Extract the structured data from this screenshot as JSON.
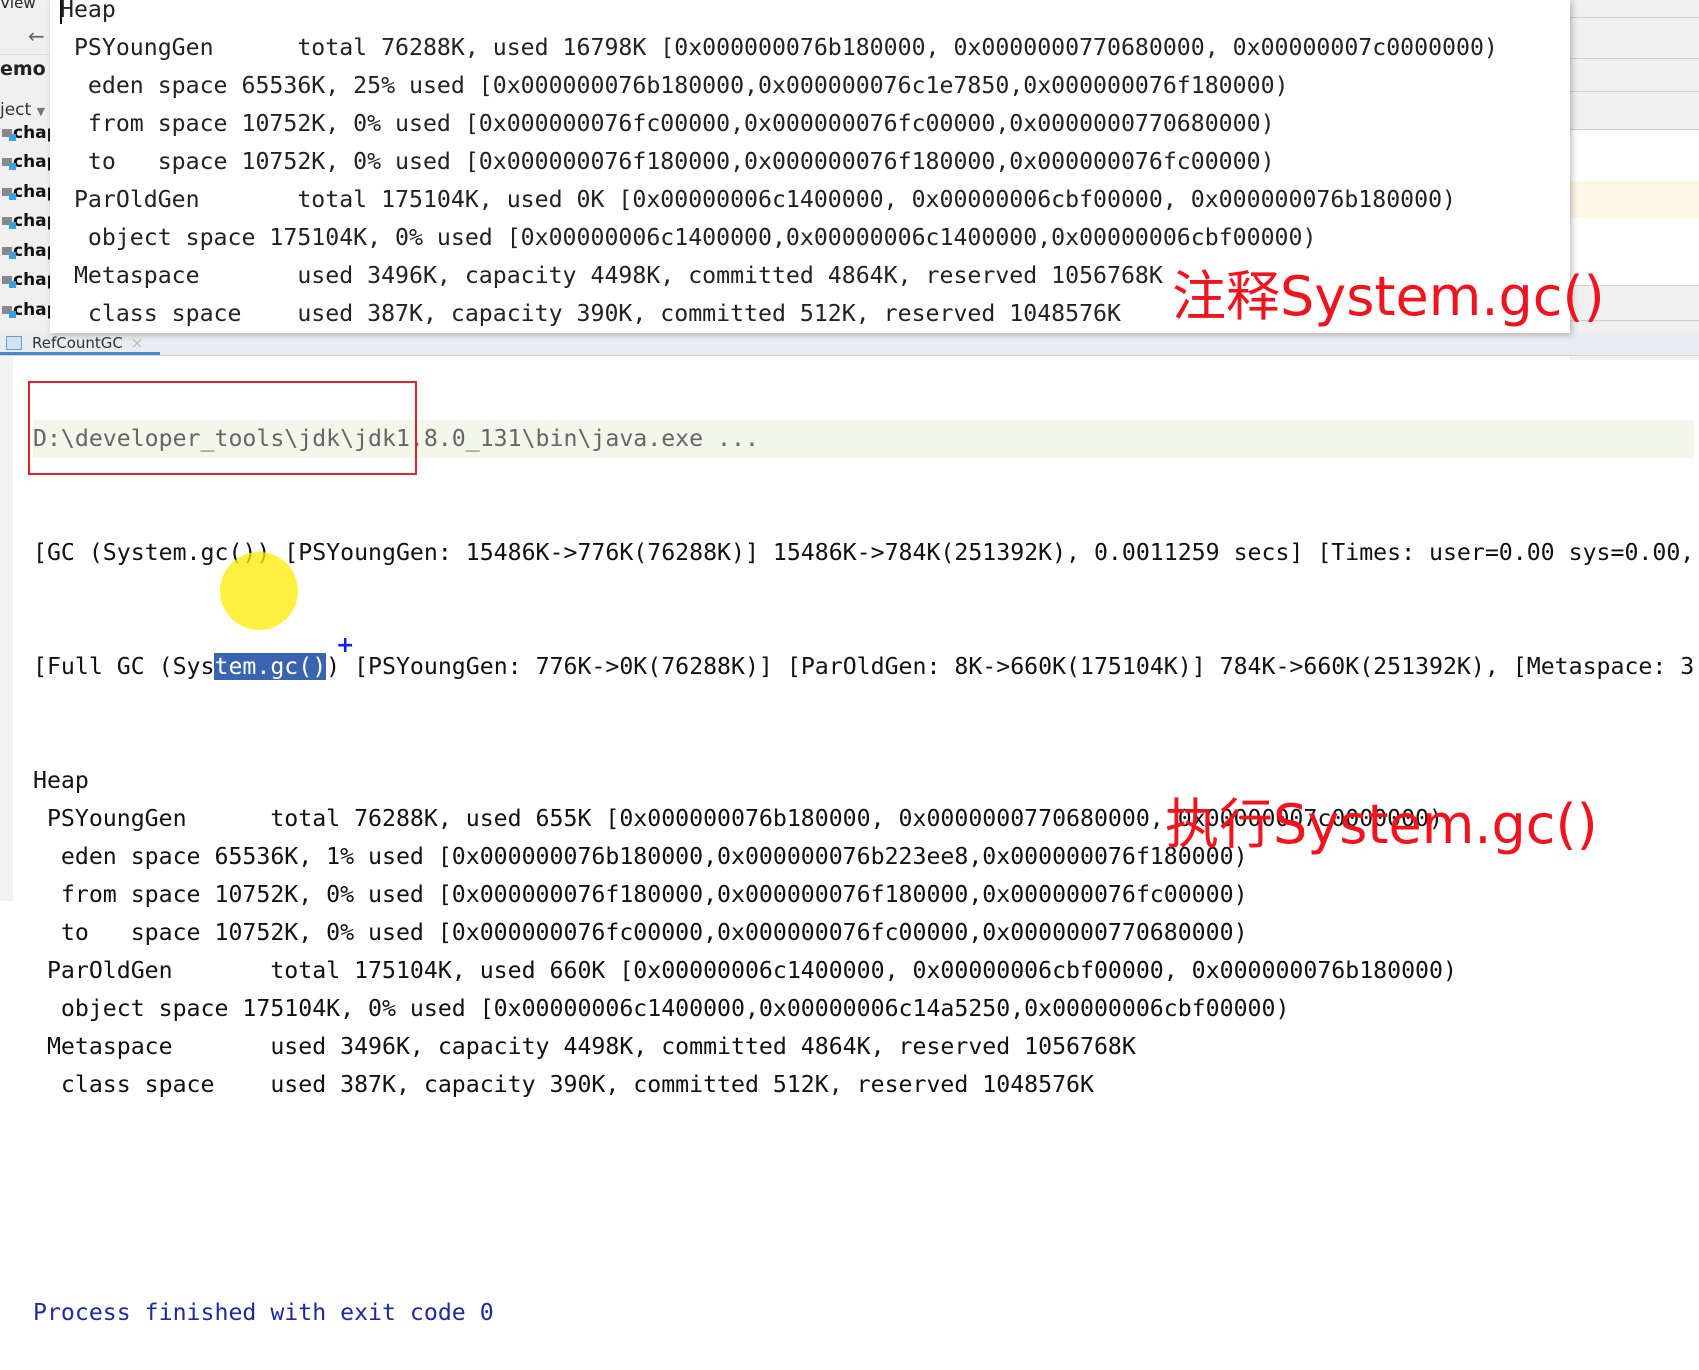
{
  "sidebar": {
    "menu_label": "View",
    "breadcrumb": "emo",
    "project_label": "ject",
    "tree_items": [
      "chap",
      "chap",
      "chap",
      "chap",
      "chap",
      "chap",
      "chap"
    ]
  },
  "tab": {
    "label": "RefCountGC",
    "close": "×"
  },
  "popup": {
    "lines": [
      "Heap",
      " PSYoungGen      total 76288K, used 16798K [0x000000076b180000, 0x0000000770680000, 0x00000007c0000000)",
      "  eden space 65536K, 25% used [0x000000076b180000,0x000000076c1e7850,0x000000076f180000)",
      "  from space 10752K, 0% used [0x000000076fc00000,0x000000076fc00000,0x0000000770680000)",
      "  to   space 10752K, 0% used [0x000000076f180000,0x000000076f180000,0x000000076fc00000)",
      " ParOldGen       total 175104K, used 0K [0x00000006c1400000, 0x00000006cbf00000, 0x000000076b180000)",
      "  object space 175104K, 0% used [0x00000006c1400000,0x00000006c1400000,0x00000006cbf00000)",
      " Metaspace       used 3496K, capacity 4498K, committed 4864K, reserved 1056768K",
      "  class space    used 387K, capacity 390K, committed 512K, reserved 1048576K"
    ]
  },
  "console": {
    "command": "D:\\developer_tools\\jdk\\jdk1.8.0_131\\bin\\java.exe ...",
    "gc_line": "[GC (System.gc()) [PSYoungGen: 15486K->776K(76288K)] 15486K->784K(251392K), 0.0011259 secs] [Times: user=0.00 sys=0.00,",
    "full_gc_before": "[Full GC (Sys",
    "full_gc_selected": "tem.gc()",
    "full_gc_after": ") [PSYoungGen: 776K->0K(76288K)] [ParOldGen: 8K->660K(175104K)] 784K->660K(251392K), [Metaspace: 3",
    "heap_lines": [
      "Heap",
      " PSYoungGen      total 76288K, used 655K [0x000000076b180000, 0x0000000770680000, 0x00000007c0000000)",
      "  eden space 65536K, 1% used [0x000000076b180000,0x000000076b223ee8,0x000000076f180000)",
      "  from space 10752K, 0% used [0x000000076f180000,0x000000076f180000,0x000000076fc00000)",
      "  to   space 10752K, 0% used [0x000000076fc00000,0x000000076fc00000,0x0000000770680000)",
      " ParOldGen       total 175104K, used 660K [0x00000006c1400000, 0x00000006cbf00000, 0x000000076b180000)",
      "  object space 175104K, 0% used [0x00000006c1400000,0x00000006c14a5250,0x00000006cbf00000)",
      " Metaspace       used 3496K, capacity 4498K, committed 4864K, reserved 1056768K",
      "  class space    used 387K, capacity 390K, committed 512K, reserved 1048576K"
    ],
    "exit_line": "Process finished with exit code 0"
  },
  "annotations": {
    "top": "注释System.gc()",
    "bottom": "执行System.gc()"
  },
  "colors": {
    "annotation": "#f0141e",
    "selection": "#3a64b0",
    "highlight": "#ffeb00",
    "box": "#e8202a"
  }
}
